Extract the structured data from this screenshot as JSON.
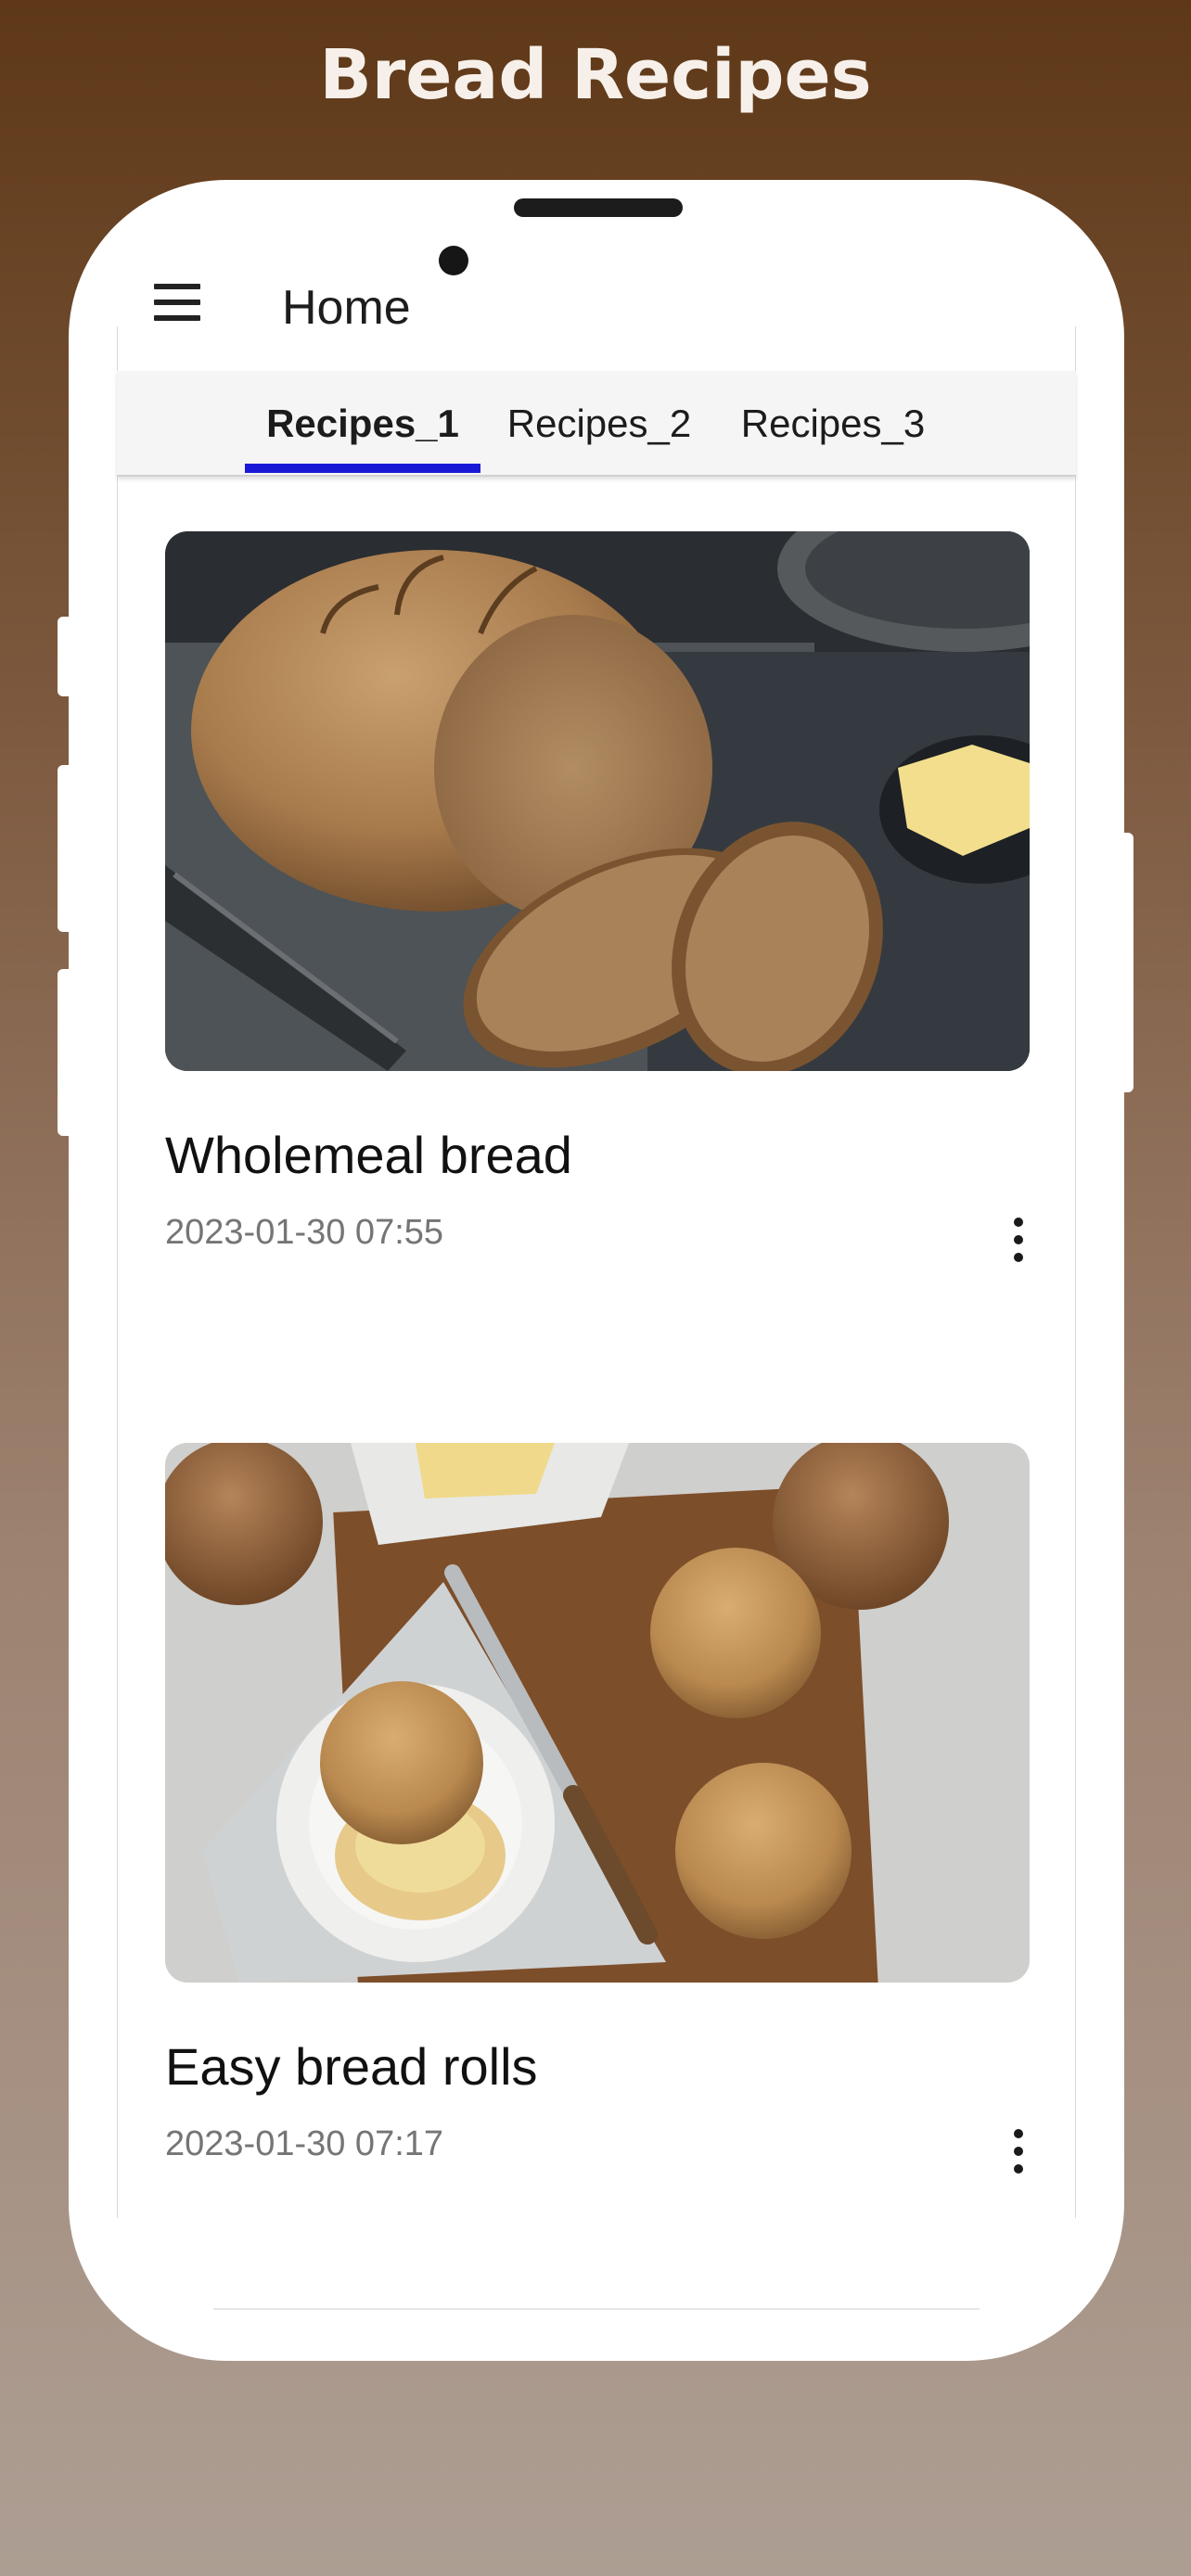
{
  "promo": {
    "title": "Bread Recipes"
  },
  "app_bar": {
    "menu_icon": "hamburger-menu-icon",
    "title": "Home"
  },
  "tabs": [
    {
      "label": "Recipes_1",
      "active": true
    },
    {
      "label": "Recipes_2",
      "active": false
    },
    {
      "label": "Recipes_3",
      "active": false
    }
  ],
  "colors": {
    "tab_indicator": "#1a1ad6",
    "background_top": "#5e3817",
    "background_bottom": "#ad9e93"
  },
  "recipes": [
    {
      "title": "Wholemeal bread",
      "date": "2023-01-30 07:55",
      "image": "wholemeal-loaf-photo",
      "menu_icon": "more-vertical-icon"
    },
    {
      "title": "Easy bread rolls",
      "date": "2023-01-30 07:17",
      "image": "bread-rolls-photo",
      "menu_icon": "more-vertical-icon"
    }
  ]
}
